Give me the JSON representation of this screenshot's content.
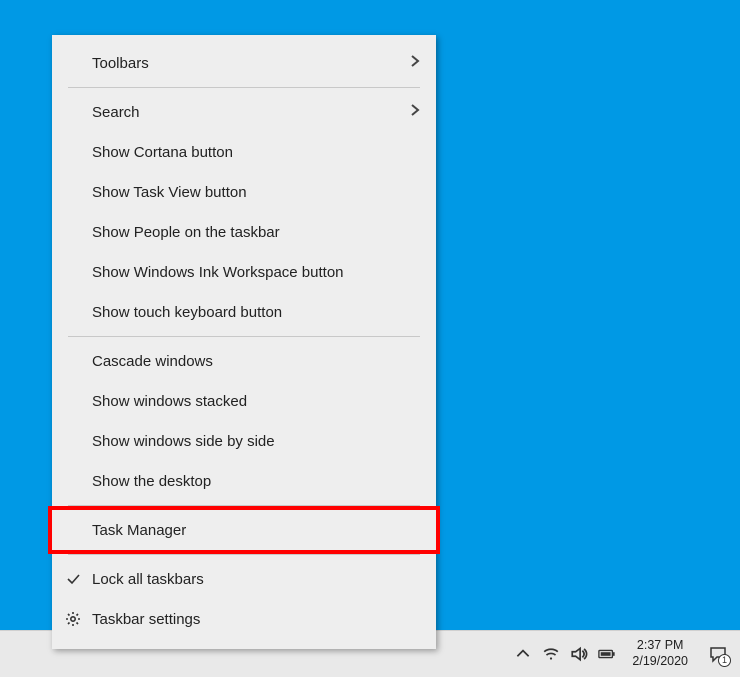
{
  "menu": {
    "groups": [
      [
        {
          "id": "toolbars",
          "label": "Toolbars",
          "submenu": true
        }
      ],
      [
        {
          "id": "search",
          "label": "Search",
          "submenu": true
        },
        {
          "id": "show-cortana",
          "label": "Show Cortana button"
        },
        {
          "id": "show-taskview",
          "label": "Show Task View button"
        },
        {
          "id": "show-people",
          "label": "Show People on the taskbar"
        },
        {
          "id": "show-ink",
          "label": "Show Windows Ink Workspace button"
        },
        {
          "id": "show-touchkb",
          "label": "Show touch keyboard button"
        }
      ],
      [
        {
          "id": "cascade",
          "label": "Cascade windows"
        },
        {
          "id": "stacked",
          "label": "Show windows stacked"
        },
        {
          "id": "sidebyside",
          "label": "Show windows side by side"
        },
        {
          "id": "show-desktop",
          "label": "Show the desktop"
        }
      ],
      [
        {
          "id": "task-manager",
          "label": "Task Manager",
          "highlighted": true
        }
      ],
      [
        {
          "id": "lock-taskbars",
          "label": "Lock all taskbars",
          "icon": "check"
        },
        {
          "id": "taskbar-settings",
          "label": "Taskbar settings",
          "icon": "gear"
        }
      ]
    ]
  },
  "systray": {
    "time": "2:37 PM",
    "date": "2/19/2020",
    "notification_count": "1"
  }
}
